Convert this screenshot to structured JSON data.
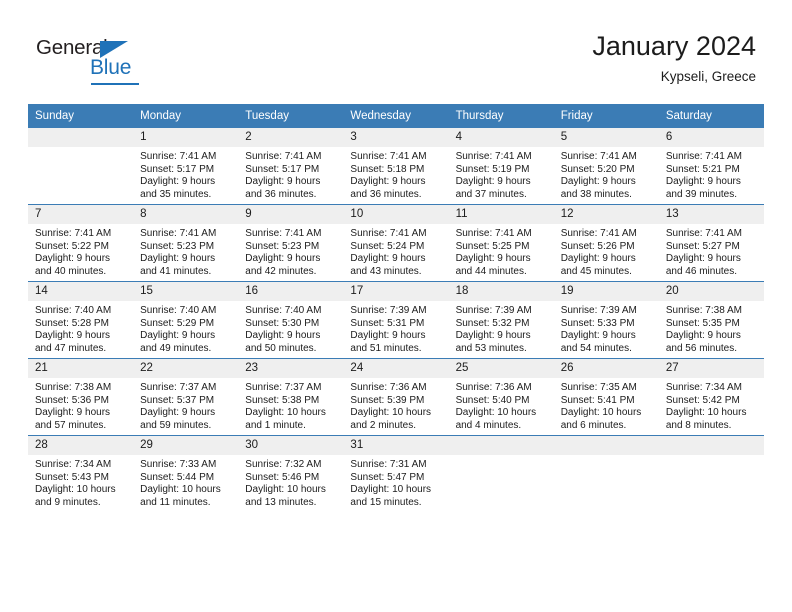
{
  "brand": {
    "name_part1": "General",
    "name_part2": "Blue"
  },
  "header": {
    "title": "January 2024",
    "subtitle": "Kypseli, Greece"
  },
  "calendar": {
    "weekday_headers": [
      "Sunday",
      "Monday",
      "Tuesday",
      "Wednesday",
      "Thursday",
      "Friday",
      "Saturday"
    ],
    "accent_color": "#3b7cb5",
    "daynum_band_color": "#efefef",
    "weeks": [
      [
        {
          "day": "",
          "sunrise": "",
          "sunset": "",
          "daylight_line1": "",
          "daylight_line2": ""
        },
        {
          "day": "1",
          "sunrise": "Sunrise: 7:41 AM",
          "sunset": "Sunset: 5:17 PM",
          "daylight_line1": "Daylight: 9 hours",
          "daylight_line2": "and 35 minutes."
        },
        {
          "day": "2",
          "sunrise": "Sunrise: 7:41 AM",
          "sunset": "Sunset: 5:17 PM",
          "daylight_line1": "Daylight: 9 hours",
          "daylight_line2": "and 36 minutes."
        },
        {
          "day": "3",
          "sunrise": "Sunrise: 7:41 AM",
          "sunset": "Sunset: 5:18 PM",
          "daylight_line1": "Daylight: 9 hours",
          "daylight_line2": "and 36 minutes."
        },
        {
          "day": "4",
          "sunrise": "Sunrise: 7:41 AM",
          "sunset": "Sunset: 5:19 PM",
          "daylight_line1": "Daylight: 9 hours",
          "daylight_line2": "and 37 minutes."
        },
        {
          "day": "5",
          "sunrise": "Sunrise: 7:41 AM",
          "sunset": "Sunset: 5:20 PM",
          "daylight_line1": "Daylight: 9 hours",
          "daylight_line2": "and 38 minutes."
        },
        {
          "day": "6",
          "sunrise": "Sunrise: 7:41 AM",
          "sunset": "Sunset: 5:21 PM",
          "daylight_line1": "Daylight: 9 hours",
          "daylight_line2": "and 39 minutes."
        }
      ],
      [
        {
          "day": "7",
          "sunrise": "Sunrise: 7:41 AM",
          "sunset": "Sunset: 5:22 PM",
          "daylight_line1": "Daylight: 9 hours",
          "daylight_line2": "and 40 minutes."
        },
        {
          "day": "8",
          "sunrise": "Sunrise: 7:41 AM",
          "sunset": "Sunset: 5:23 PM",
          "daylight_line1": "Daylight: 9 hours",
          "daylight_line2": "and 41 minutes."
        },
        {
          "day": "9",
          "sunrise": "Sunrise: 7:41 AM",
          "sunset": "Sunset: 5:23 PM",
          "daylight_line1": "Daylight: 9 hours",
          "daylight_line2": "and 42 minutes."
        },
        {
          "day": "10",
          "sunrise": "Sunrise: 7:41 AM",
          "sunset": "Sunset: 5:24 PM",
          "daylight_line1": "Daylight: 9 hours",
          "daylight_line2": "and 43 minutes."
        },
        {
          "day": "11",
          "sunrise": "Sunrise: 7:41 AM",
          "sunset": "Sunset: 5:25 PM",
          "daylight_line1": "Daylight: 9 hours",
          "daylight_line2": "and 44 minutes."
        },
        {
          "day": "12",
          "sunrise": "Sunrise: 7:41 AM",
          "sunset": "Sunset: 5:26 PM",
          "daylight_line1": "Daylight: 9 hours",
          "daylight_line2": "and 45 minutes."
        },
        {
          "day": "13",
          "sunrise": "Sunrise: 7:41 AM",
          "sunset": "Sunset: 5:27 PM",
          "daylight_line1": "Daylight: 9 hours",
          "daylight_line2": "and 46 minutes."
        }
      ],
      [
        {
          "day": "14",
          "sunrise": "Sunrise: 7:40 AM",
          "sunset": "Sunset: 5:28 PM",
          "daylight_line1": "Daylight: 9 hours",
          "daylight_line2": "and 47 minutes."
        },
        {
          "day": "15",
          "sunrise": "Sunrise: 7:40 AM",
          "sunset": "Sunset: 5:29 PM",
          "daylight_line1": "Daylight: 9 hours",
          "daylight_line2": "and 49 minutes."
        },
        {
          "day": "16",
          "sunrise": "Sunrise: 7:40 AM",
          "sunset": "Sunset: 5:30 PM",
          "daylight_line1": "Daylight: 9 hours",
          "daylight_line2": "and 50 minutes."
        },
        {
          "day": "17",
          "sunrise": "Sunrise: 7:39 AM",
          "sunset": "Sunset: 5:31 PM",
          "daylight_line1": "Daylight: 9 hours",
          "daylight_line2": "and 51 minutes."
        },
        {
          "day": "18",
          "sunrise": "Sunrise: 7:39 AM",
          "sunset": "Sunset: 5:32 PM",
          "daylight_line1": "Daylight: 9 hours",
          "daylight_line2": "and 53 minutes."
        },
        {
          "day": "19",
          "sunrise": "Sunrise: 7:39 AM",
          "sunset": "Sunset: 5:33 PM",
          "daylight_line1": "Daylight: 9 hours",
          "daylight_line2": "and 54 minutes."
        },
        {
          "day": "20",
          "sunrise": "Sunrise: 7:38 AM",
          "sunset": "Sunset: 5:35 PM",
          "daylight_line1": "Daylight: 9 hours",
          "daylight_line2": "and 56 minutes."
        }
      ],
      [
        {
          "day": "21",
          "sunrise": "Sunrise: 7:38 AM",
          "sunset": "Sunset: 5:36 PM",
          "daylight_line1": "Daylight: 9 hours",
          "daylight_line2": "and 57 minutes."
        },
        {
          "day": "22",
          "sunrise": "Sunrise: 7:37 AM",
          "sunset": "Sunset: 5:37 PM",
          "daylight_line1": "Daylight: 9 hours",
          "daylight_line2": "and 59 minutes."
        },
        {
          "day": "23",
          "sunrise": "Sunrise: 7:37 AM",
          "sunset": "Sunset: 5:38 PM",
          "daylight_line1": "Daylight: 10 hours",
          "daylight_line2": "and 1 minute."
        },
        {
          "day": "24",
          "sunrise": "Sunrise: 7:36 AM",
          "sunset": "Sunset: 5:39 PM",
          "daylight_line1": "Daylight: 10 hours",
          "daylight_line2": "and 2 minutes."
        },
        {
          "day": "25",
          "sunrise": "Sunrise: 7:36 AM",
          "sunset": "Sunset: 5:40 PM",
          "daylight_line1": "Daylight: 10 hours",
          "daylight_line2": "and 4 minutes."
        },
        {
          "day": "26",
          "sunrise": "Sunrise: 7:35 AM",
          "sunset": "Sunset: 5:41 PM",
          "daylight_line1": "Daylight: 10 hours",
          "daylight_line2": "and 6 minutes."
        },
        {
          "day": "27",
          "sunrise": "Sunrise: 7:34 AM",
          "sunset": "Sunset: 5:42 PM",
          "daylight_line1": "Daylight: 10 hours",
          "daylight_line2": "and 8 minutes."
        }
      ],
      [
        {
          "day": "28",
          "sunrise": "Sunrise: 7:34 AM",
          "sunset": "Sunset: 5:43 PM",
          "daylight_line1": "Daylight: 10 hours",
          "daylight_line2": "and 9 minutes."
        },
        {
          "day": "29",
          "sunrise": "Sunrise: 7:33 AM",
          "sunset": "Sunset: 5:44 PM",
          "daylight_line1": "Daylight: 10 hours",
          "daylight_line2": "and 11 minutes."
        },
        {
          "day": "30",
          "sunrise": "Sunrise: 7:32 AM",
          "sunset": "Sunset: 5:46 PM",
          "daylight_line1": "Daylight: 10 hours",
          "daylight_line2": "and 13 minutes."
        },
        {
          "day": "31",
          "sunrise": "Sunrise: 7:31 AM",
          "sunset": "Sunset: 5:47 PM",
          "daylight_line1": "Daylight: 10 hours",
          "daylight_line2": "and 15 minutes."
        },
        {
          "day": "",
          "sunrise": "",
          "sunset": "",
          "daylight_line1": "",
          "daylight_line2": ""
        },
        {
          "day": "",
          "sunrise": "",
          "sunset": "",
          "daylight_line1": "",
          "daylight_line2": ""
        },
        {
          "day": "",
          "sunrise": "",
          "sunset": "",
          "daylight_line1": "",
          "daylight_line2": ""
        }
      ]
    ]
  }
}
